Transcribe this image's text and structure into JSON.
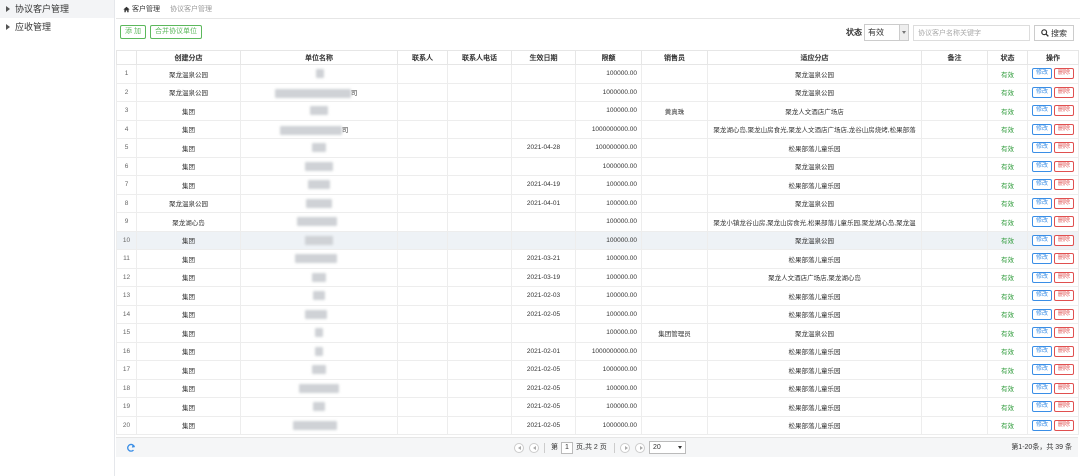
{
  "sidebar": {
    "items": [
      {
        "label": "协议客户管理",
        "active": true
      },
      {
        "label": "应收管理",
        "active": false
      }
    ]
  },
  "breadcrumb": {
    "home": "客户管理",
    "current": "协议客户管理"
  },
  "toolbar": {
    "add_label": "添 加",
    "merge_label": "合并协议单位",
    "status_label": "状态",
    "status_value": "有效",
    "search_placeholder": "协议客户名称关键字",
    "search_label": "搜索"
  },
  "table": {
    "columns": [
      "",
      "创建分店",
      "单位名称",
      "联系人",
      "联系人电话",
      "生效日期",
      "限额",
      "销售员",
      "适应分店",
      "备注",
      "状态",
      "操作"
    ],
    "edit_label": "修改",
    "delete_label": "删除",
    "rows": [
      {
        "no": "1",
        "branch": "聚龙温泉公园",
        "unit": "",
        "contact": "",
        "phone": "",
        "date": "",
        "limit": "100000.00",
        "sales": "",
        "stores": "聚龙温泉公园",
        "remark": "",
        "status": "有效"
      },
      {
        "no": "2",
        "branch": "聚龙温泉公园",
        "unit": "司",
        "contact": "",
        "phone": "",
        "date": "",
        "limit": "1000000.00",
        "sales": "",
        "stores": "聚龙温泉公园",
        "remark": "",
        "status": "有效"
      },
      {
        "no": "3",
        "branch": "集团",
        "unit": "",
        "contact": "",
        "phone": "",
        "date": "",
        "limit": "100000.00",
        "sales": "黄真珠",
        "stores": "聚龙人文酒店广场店",
        "remark": "",
        "status": "有效"
      },
      {
        "no": "4",
        "branch": "集团",
        "unit": "司",
        "contact": "",
        "phone": "",
        "date": "",
        "limit": "1000000000.00",
        "sales": "",
        "stores": "聚龙湖心岛,聚龙山房食光,聚龙人文酒店广场店,龙谷山房烧烤,松果部落",
        "remark": "",
        "status": "有效"
      },
      {
        "no": "5",
        "branch": "集团",
        "unit": "",
        "contact": "",
        "phone": "",
        "date": "2021-04-28",
        "limit": "100000000.00",
        "sales": "",
        "stores": "松果部落儿童乐园",
        "remark": "",
        "status": "有效"
      },
      {
        "no": "6",
        "branch": "集团",
        "unit": "",
        "contact": "",
        "phone": "",
        "date": "",
        "limit": "1000000.00",
        "sales": "",
        "stores": "聚龙温泉公园",
        "remark": "",
        "status": "有效"
      },
      {
        "no": "7",
        "branch": "集团",
        "unit": "",
        "contact": "",
        "phone": "",
        "date": "2021-04-19",
        "limit": "100000.00",
        "sales": "",
        "stores": "松果部落儿童乐园",
        "remark": "",
        "status": "有效"
      },
      {
        "no": "8",
        "branch": "聚龙温泉公园",
        "unit": "",
        "contact": "",
        "phone": "",
        "date": "2021-04-01",
        "limit": "100000.00",
        "sales": "",
        "stores": "聚龙温泉公园",
        "remark": "",
        "status": "有效"
      },
      {
        "no": "9",
        "branch": "聚龙湖心岛",
        "unit": "",
        "contact": "",
        "phone": "",
        "date": "",
        "limit": "100000.00",
        "sales": "",
        "stores": "聚龙小镇龙谷山房,聚龙山房食光,松果部落儿童乐园,聚龙湖心岛,聚龙温",
        "remark": "",
        "status": "有效"
      },
      {
        "no": "10",
        "branch": "集团",
        "unit": "",
        "contact": "",
        "phone": "",
        "date": "",
        "limit": "100000.00",
        "sales": "",
        "stores": "聚龙温泉公园",
        "remark": "",
        "status": "有效"
      },
      {
        "no": "11",
        "branch": "集团",
        "unit": "",
        "contact": "",
        "phone": "",
        "date": "2021-03-21",
        "limit": "100000.00",
        "sales": "",
        "stores": "松果部落儿童乐园",
        "remark": "",
        "status": "有效"
      },
      {
        "no": "12",
        "branch": "集团",
        "unit": "",
        "contact": "",
        "phone": "",
        "date": "2021-03-19",
        "limit": "100000.00",
        "sales": "",
        "stores": "聚龙人文酒店广场店,聚龙湖心岛",
        "remark": "",
        "status": "有效"
      },
      {
        "no": "13",
        "branch": "集团",
        "unit": "",
        "contact": "",
        "phone": "",
        "date": "2021-02-03",
        "limit": "100000.00",
        "sales": "",
        "stores": "松果部落儿童乐园",
        "remark": "",
        "status": "有效"
      },
      {
        "no": "14",
        "branch": "集团",
        "unit": "",
        "contact": "",
        "phone": "",
        "date": "2021-02-05",
        "limit": "100000.00",
        "sales": "",
        "stores": "松果部落儿童乐园",
        "remark": "",
        "status": "有效"
      },
      {
        "no": "15",
        "branch": "集团",
        "unit": "",
        "contact": "",
        "phone": "",
        "date": "",
        "limit": "100000.00",
        "sales": "集团管理员",
        "stores": "聚龙温泉公园",
        "remark": "",
        "status": "有效"
      },
      {
        "no": "16",
        "branch": "集团",
        "unit": "",
        "contact": "",
        "phone": "",
        "date": "2021-02-01",
        "limit": "1000000000.00",
        "sales": "",
        "stores": "松果部落儿童乐园",
        "remark": "",
        "status": "有效"
      },
      {
        "no": "17",
        "branch": "集团",
        "unit": "",
        "contact": "",
        "phone": "",
        "date": "2021-02-05",
        "limit": "1000000.00",
        "sales": "",
        "stores": "松果部落儿童乐园",
        "remark": "",
        "status": "有效"
      },
      {
        "no": "18",
        "branch": "集团",
        "unit": "",
        "contact": "",
        "phone": "",
        "date": "2021-02-05",
        "limit": "100000.00",
        "sales": "",
        "stores": "松果部落儿童乐园",
        "remark": "",
        "status": "有效"
      },
      {
        "no": "19",
        "branch": "集团",
        "unit": "",
        "contact": "",
        "phone": "",
        "date": "2021-02-05",
        "limit": "100000.00",
        "sales": "",
        "stores": "松果部落儿童乐园",
        "remark": "",
        "status": "有效"
      },
      {
        "no": "20",
        "branch": "集团",
        "unit": "",
        "contact": "",
        "phone": "",
        "date": "2021-02-05",
        "limit": "1000000.00",
        "sales": "",
        "stores": "松果部落儿童乐园",
        "remark": "",
        "status": "有效"
      }
    ]
  },
  "pager": {
    "page_prefix": "第",
    "page_value": "1",
    "page_suffix": "页,共 2 页",
    "page_size": "20",
    "range": "第1-20条，共 39 条"
  },
  "colors": {
    "accent": "#3a8ee6",
    "status_green": "#2e9b3a",
    "danger": "#e05050",
    "add_green": "#5cb85c"
  },
  "icons": {
    "home": "home-icon",
    "search": "search-icon",
    "refresh": "refresh-icon",
    "caret": "caret-right-icon"
  }
}
